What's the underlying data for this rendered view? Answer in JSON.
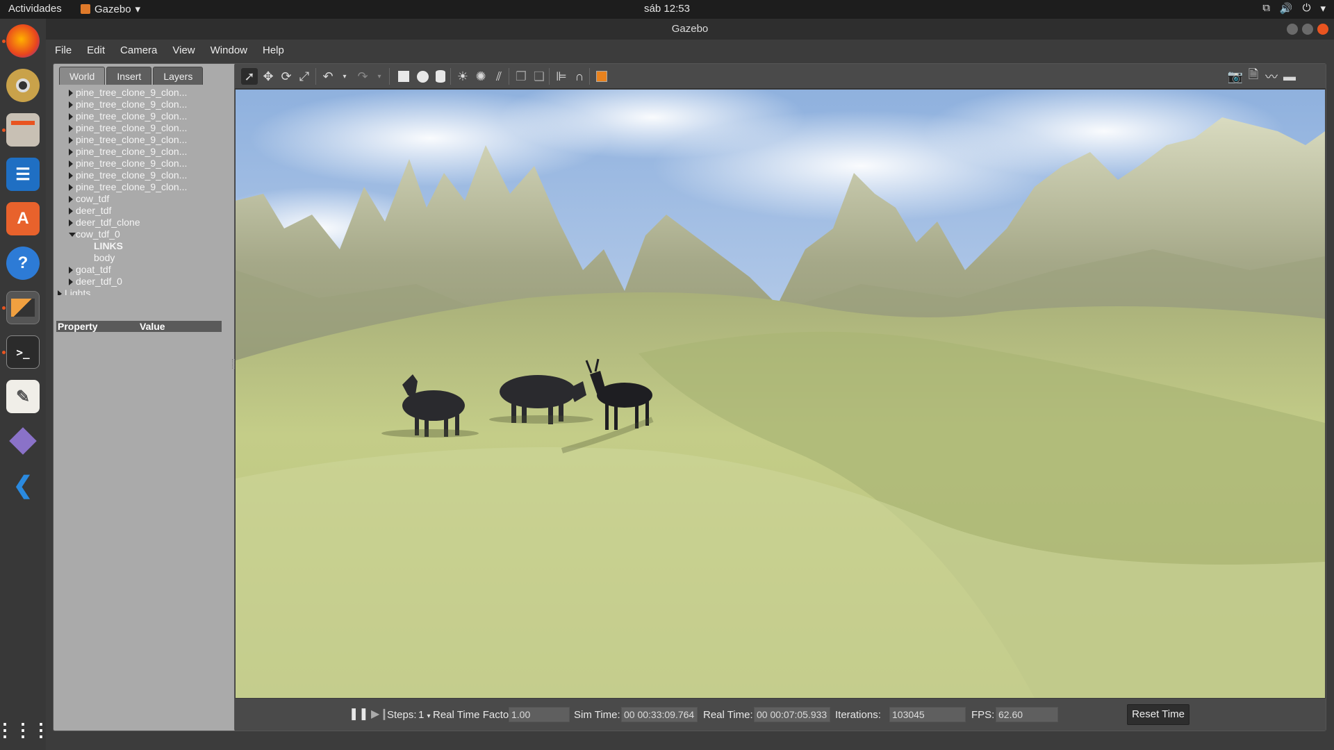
{
  "topbar": {
    "activities": "Actividades",
    "app_name": "Gazebo",
    "clock": "sáb 12:53"
  },
  "dock": {
    "apps": [
      "firefox-icon",
      "rhythmbox-icon",
      "files-icon",
      "writer-icon",
      "software-icon",
      "help-icon",
      "gazebo-icon",
      "terminal-icon",
      "text-editor-icon",
      "unknown-app-icon",
      "vscode-icon",
      "show-apps-icon"
    ]
  },
  "window": {
    "title": "Gazebo"
  },
  "menu": [
    "File",
    "Edit",
    "Camera",
    "View",
    "Window",
    "Help"
  ],
  "left_panel": {
    "tabs": [
      "World",
      "Insert",
      "Layers"
    ],
    "tree": [
      {
        "label": "pine_tree_clone_9_clon...",
        "arrow": "right",
        "level": 1
      },
      {
        "label": "pine_tree_clone_9_clon...",
        "arrow": "right",
        "level": 1
      },
      {
        "label": "pine_tree_clone_9_clon...",
        "arrow": "right",
        "level": 1
      },
      {
        "label": "pine_tree_clone_9_clon...",
        "arrow": "right",
        "level": 1
      },
      {
        "label": "pine_tree_clone_9_clon...",
        "arrow": "right",
        "level": 1
      },
      {
        "label": "pine_tree_clone_9_clon...",
        "arrow": "right",
        "level": 1
      },
      {
        "label": "pine_tree_clone_9_clon...",
        "arrow": "right",
        "level": 1
      },
      {
        "label": "pine_tree_clone_9_clon...",
        "arrow": "right",
        "level": 1
      },
      {
        "label": "pine_tree_clone_9_clon...",
        "arrow": "right",
        "level": 1
      },
      {
        "label": "cow_tdf",
        "arrow": "right",
        "level": 1
      },
      {
        "label": "deer_tdf",
        "arrow": "right",
        "level": 1
      },
      {
        "label": "deer_tdf_clone",
        "arrow": "right",
        "level": 1
      },
      {
        "label": "cow_tdf_0",
        "arrow": "down",
        "level": 1
      },
      {
        "label": "LINKS",
        "arrow": "none",
        "level": 2,
        "bold": true
      },
      {
        "label": "body",
        "arrow": "none",
        "level": 2
      },
      {
        "label": "goat_tdf",
        "arrow": "right",
        "level": 1
      },
      {
        "label": "deer_tdf_0",
        "arrow": "right",
        "level": 1
      },
      {
        "label": "Lights",
        "arrow": "right",
        "level": 0
      }
    ],
    "property_header": "Property",
    "value_header": "Value"
  },
  "toolbar": {
    "tools": [
      "select-arrow-icon",
      "translate-icon",
      "rotate-icon",
      "scale-icon",
      "undo-icon",
      "undo-dropdown-icon",
      "redo-icon",
      "redo-dropdown-icon",
      "box-shape-icon",
      "sphere-shape-icon",
      "cylinder-shape-icon",
      "point-light-icon",
      "spot-light-icon",
      "directional-light-icon",
      "copy-icon",
      "paste-icon",
      "align-icon",
      "snap-icon",
      "view-angle-icon"
    ],
    "right_tools": [
      "screenshot-icon",
      "log-icon",
      "plot-icon",
      "video-record-icon"
    ]
  },
  "bottom": {
    "steps_label": "Steps:",
    "steps_value": "1",
    "rtf_label": "Real Time Factor:",
    "rtf_value": "1.00",
    "sim_time_label": "Sim Time:",
    "sim_time_value": "00 00:33:09.764",
    "real_time_label": "Real Time:",
    "real_time_value": "00 00:07:05.933",
    "iterations_label": "Iterations:",
    "iterations_value": "103045",
    "fps_label": "FPS:",
    "fps_value": "62.60",
    "reset_label": "Reset Time"
  },
  "colors": {
    "accent": "#e95420",
    "sky": "#a9c3e6",
    "grass": "#b9c27a",
    "mountain": "#b6b898"
  }
}
